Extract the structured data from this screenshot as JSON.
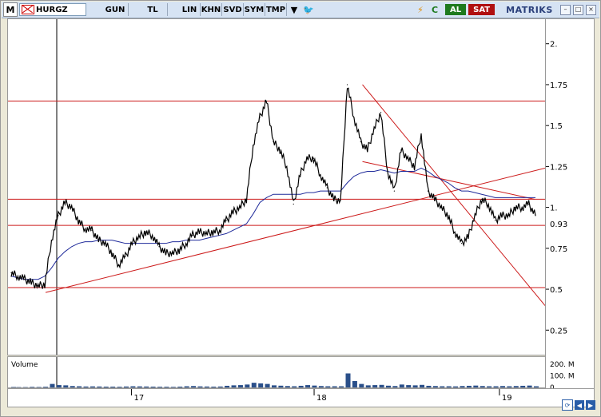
{
  "toolbar": {
    "logo": "M",
    "symbol": "HURGZ",
    "buttons": [
      "GUN",
      "TL",
      "LIN",
      "KHN",
      "SVD",
      "SYM",
      "TMP"
    ],
    "al_label": "AL",
    "sat_label": "SAT",
    "brand": "MATRIKS",
    "colors": {
      "toolbar_bg": "#d6e3f3",
      "al_bg": "#1e7a1e",
      "sat_bg": "#b01010"
    }
  },
  "chart_data": {
    "type": "line",
    "series": [
      {
        "values": [
          0.6,
          0.58,
          0.56,
          0.54,
          0.52,
          0.53,
          0.8,
          0.95,
          1.03,
          1.0,
          0.92,
          0.87,
          0.86,
          0.8,
          0.78,
          0.72,
          0.65,
          0.7,
          0.78,
          0.82,
          0.85,
          0.83,
          0.76,
          0.72,
          0.72,
          0.74,
          0.78,
          0.83,
          0.85,
          0.84,
          0.85,
          0.86,
          0.92,
          0.97,
          1.0,
          1.05,
          1.38,
          1.55,
          1.65,
          1.4,
          1.35,
          1.25,
          1.02,
          1.2,
          1.3,
          1.3,
          1.2,
          1.12,
          1.05,
          1.04,
          1.75,
          1.55,
          1.4,
          1.35,
          1.48,
          1.58,
          1.22,
          1.1,
          1.35,
          1.3,
          1.25,
          1.45,
          1.1,
          1.05,
          1.0,
          0.95,
          0.85,
          0.78,
          0.82,
          0.95,
          1.05,
          1.02,
          0.92,
          0.95,
          0.95,
          1.0,
          1.0,
          1.02,
          0.95
        ]
      },
      {
        "values": [
          0.58,
          0.57,
          0.56,
          0.56,
          0.56,
          0.58,
          0.63,
          0.69,
          0.73,
          0.76,
          0.78,
          0.79,
          0.79,
          0.8,
          0.8,
          0.8,
          0.79,
          0.78,
          0.78,
          0.78,
          0.78,
          0.78,
          0.78,
          0.78,
          0.79,
          0.79,
          0.8,
          0.8,
          0.8,
          0.81,
          0.82,
          0.83,
          0.84,
          0.86,
          0.88,
          0.9,
          0.96,
          1.03,
          1.06,
          1.08,
          1.08,
          1.08,
          1.08,
          1.08,
          1.09,
          1.09,
          1.1,
          1.1,
          1.1,
          1.1,
          1.15,
          1.19,
          1.21,
          1.22,
          1.22,
          1.23,
          1.22,
          1.21,
          1.22,
          1.22,
          1.22,
          1.24,
          1.22,
          1.19,
          1.17,
          1.15,
          1.12,
          1.1,
          1.1,
          1.09,
          1.08,
          1.07,
          1.06,
          1.06,
          1.06,
          1.06,
          1.06,
          1.06,
          1.06
        ]
      }
    ],
    "x_labels": [
      "17",
      "18",
      "19"
    ],
    "y_ticks": [
      0.25,
      0.5,
      0.75,
      1.0,
      1.25,
      1.5,
      1.75,
      2.0
    ],
    "y_tick_labels": [
      "0.25",
      "0.5",
      "0.75",
      "1.",
      "1.25",
      "1.5",
      "1.75",
      "2."
    ],
    "last_value_label": "0.93",
    "ylim": [
      0.1,
      2.15
    ],
    "hlines": [
      1.65,
      1.05,
      0.89,
      0.51
    ],
    "trendlines": [
      {
        "from": [
          0.07,
          0.48
        ],
        "to": [
          1.0,
          1.24
        ]
      },
      {
        "from": [
          0.66,
          1.75
        ],
        "to": [
          1.0,
          0.4
        ]
      },
      {
        "from": [
          0.66,
          1.28
        ],
        "to": [
          0.98,
          1.05
        ]
      }
    ],
    "volume": {
      "label": "Volume",
      "tick_labels": [
        "200. M",
        "100. M",
        "0."
      ],
      "ylim": [
        0,
        260
      ],
      "values": [
        4,
        3,
        3,
        5,
        4,
        6,
        30,
        20,
        18,
        12,
        10,
        8,
        9,
        8,
        7,
        7,
        6,
        8,
        10,
        9,
        8,
        7,
        6,
        6,
        5,
        7,
        10,
        12,
        9,
        8,
        7,
        8,
        14,
        18,
        20,
        25,
        40,
        35,
        30,
        18,
        15,
        12,
        10,
        14,
        20,
        16,
        12,
        10,
        10,
        10,
        120,
        55,
        30,
        18,
        20,
        22,
        15,
        12,
        25,
        20,
        18,
        22,
        14,
        12,
        10,
        10,
        9,
        12,
        14,
        16,
        12,
        10,
        10,
        12,
        10,
        12,
        14,
        16,
        10
      ]
    },
    "colors": {
      "price": "#000000",
      "ma": "#1f2a9a",
      "levels": "#cc1a1a",
      "volume": "#2a4f8a"
    }
  }
}
